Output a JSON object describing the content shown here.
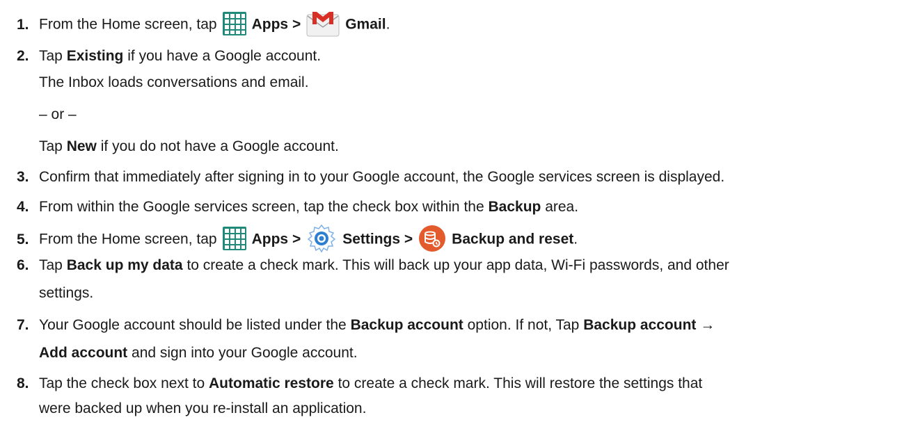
{
  "icons": {
    "apps": "apps-grid-icon",
    "gmail": "gmail-envelope-icon",
    "settings": "settings-gear-icon",
    "backup": "backup-and-reset-icon"
  },
  "colors": {
    "apps_icon": "#1f8a7a",
    "gmail_red": "#d93025",
    "settings_blue": "#2f7fd1",
    "backup_orange": "#e35b2d"
  },
  "steps": [
    {
      "num": "1.",
      "parts": [
        "From the Home screen, tap",
        "Apps >",
        "Gmail",
        "."
      ]
    },
    {
      "num": "2.",
      "parts": [
        "Tap",
        "Existing",
        "if you have a Google account."
      ],
      "sub": [
        "The Inbox loads conversations and email.",
        "– or –"
      ],
      "alt": [
        "Tap",
        "New",
        "if you do not have a Google account."
      ]
    },
    {
      "num": "3.",
      "text": "Confirm that immediately after signing in to your Google account, the Google services screen is displayed."
    },
    {
      "num": "4.",
      "parts": [
        "From within the Google services screen, tap the check box within the",
        "Backup",
        "area."
      ]
    },
    {
      "num": "5.",
      "parts": [
        "From the Home screen, tap",
        "Apps >",
        "Settings >",
        "Backup and reset",
        "."
      ]
    },
    {
      "num": "6.",
      "parts": [
        "Tap",
        "Back up my data",
        "to create a check mark. This will back up your app data, Wi-Fi passwords, and other"
      ],
      "cont": "settings."
    },
    {
      "num": "7.",
      "parts": [
        "Your Google account should be listed under the",
        "Backup account",
        "option. If not, Tap",
        "Backup account",
        "→"
      ],
      "cont_parts": [
        "Add account",
        "and sign into your Google account."
      ]
    },
    {
      "num": "8.",
      "parts": [
        "Tap the check box next to",
        "Automatic restore",
        "to create a check mark. This will restore the settings that"
      ],
      "cont": "were backed up when you re-install an application."
    }
  ]
}
